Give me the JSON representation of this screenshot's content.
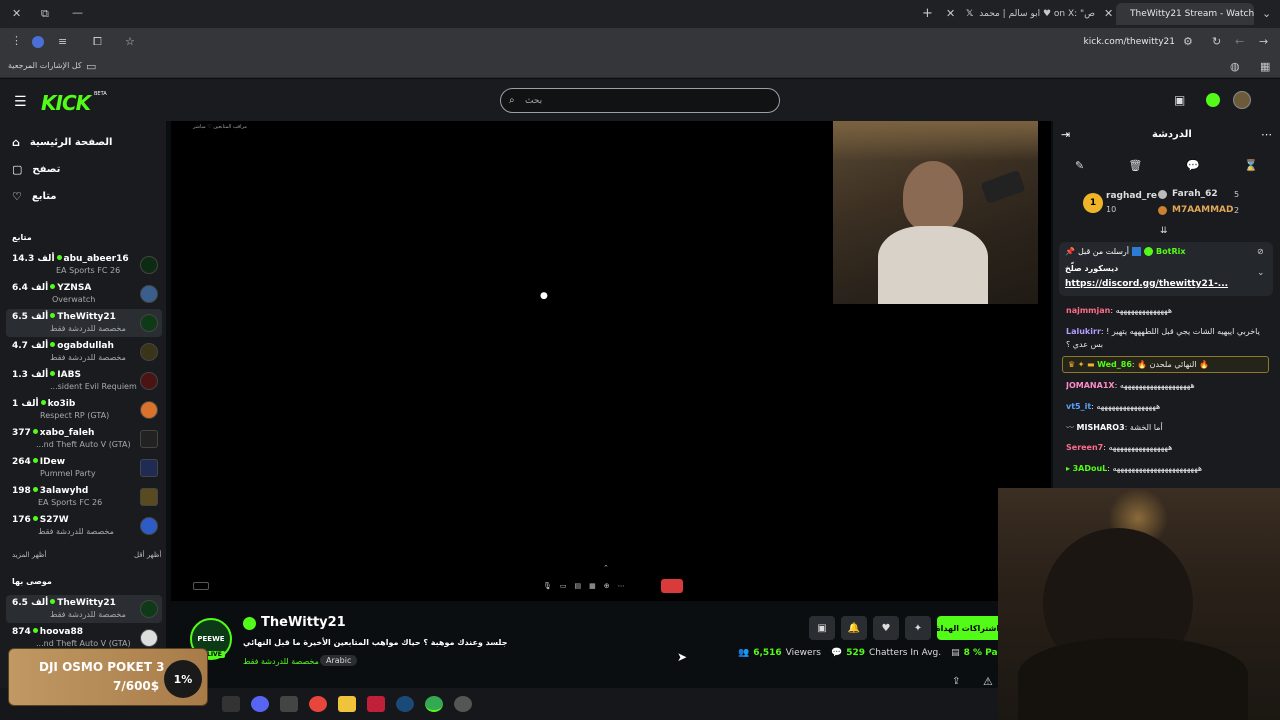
{
  "browser": {
    "tabs": [
      {
        "title": "TheWitty21 Stream - Watch",
        "active": true
      },
      {
        "title": "ابو سالم | محمد ♥ on X: \"هذا ص...",
        "active": false
      }
    ],
    "url": "kick.com/thewitty21",
    "bookmarks_label": "كل الإشارات المرجعية"
  },
  "header": {
    "logo": "KICK",
    "logo_badge": "BETA",
    "search_placeholder": "بحث"
  },
  "sidebar": {
    "nav": [
      {
        "label": "الصفحة الرئيسية",
        "icon": "home-icon"
      },
      {
        "label": "تصفح",
        "icon": "browse-icon"
      },
      {
        "label": "متابع",
        "icon": "heart-icon"
      }
    ],
    "following_title": "متابع",
    "channels": [
      {
        "viewers": "14.3 ألف",
        "name": "abu_abeer16",
        "category": "EA Sports FC 26"
      },
      {
        "viewers": "6.4 ألف",
        "name": "YZNSA",
        "category": "Overwatch"
      },
      {
        "viewers": "6.5 ألف",
        "name": "TheWitty21",
        "category": "مخصصة للدردشة فقط",
        "selected": true
      },
      {
        "viewers": "4.7 ألف",
        "name": "ogabdullah",
        "category": "مخصصة للدردشة فقط"
      },
      {
        "viewers": "1.3 ألف",
        "name": "IABS",
        "category": "...sident Evil Requiem"
      },
      {
        "viewers": "1 ألف",
        "name": "ko3ib",
        "category": "Respect RP (GTA)"
      },
      {
        "viewers": "377",
        "name": "xabo_faleh",
        "category": "...nd Theft Auto V (GTA)"
      },
      {
        "viewers": "264",
        "name": "IDew",
        "category": "Pummel Party"
      },
      {
        "viewers": "198",
        "name": "3alawyhd",
        "category": "EA Sports FC 26"
      },
      {
        "viewers": "176",
        "name": "S27W",
        "category": "مخصصة للدردشة فقط"
      }
    ],
    "show_more": "أظهر المزيد",
    "show_less": "أظهر أقل",
    "recommended_title": "موصى بها",
    "recommended": [
      {
        "viewers": "6.5 ألف",
        "name": "TheWitty21",
        "category": "مخصصة للدردشة فقط",
        "selected": true
      },
      {
        "viewers": "874",
        "name": "hoova88",
        "category": "...nd Theft Auto V (GTA)"
      }
    ]
  },
  "video": {
    "overlay_caption": "مراقب المتابعين ♡ مباشر"
  },
  "stream": {
    "channel_name": "TheWitty21",
    "avatar_text": "PEEWE",
    "live_badge": "LIVE",
    "title": "جلسد وعندك موهبة ؟ حياك مواهب المتابعين الأخيرة ما قبل النهائي",
    "category": "مخصصة للدردشة فقط",
    "language_tag": "Arabic",
    "subscribe_label": "اشتراكات الهداة",
    "viewers": "6,516",
    "viewers_label": "Viewers",
    "chatters": "529",
    "chatters_label": "Chatters In Avg.",
    "participation": "8 % Parti"
  },
  "chat": {
    "title": "الدردشة",
    "top_gifters": [
      {
        "rank": "1",
        "name": "raghad_re",
        "count": "10"
      },
      {
        "name": "Farah_62",
        "count": "5"
      },
      {
        "name": "M7AAMMAD",
        "count": "2"
      }
    ],
    "pinned": {
      "sent_by_label": "أرسلت من قبل",
      "author": "BotRix",
      "title": "ديسكورد صلّخ",
      "link": "https://discord.gg/thewitty21-..."
    },
    "messages": [
      {
        "user": "najmmjan",
        "color": "#ff6b8a",
        "text": "ههههههههههههههه"
      },
      {
        "user": "Lalukirr",
        "color": "#b59cff",
        "text": "ياخربي اييهيه الشات يجي قبل اللطهههه يتهير ! بس عدي ؟"
      },
      {
        "user": "Wed_86",
        "color": "#53fc18",
        "text": "🔥 النهائي ملحدن 🔥",
        "highlight": true
      },
      {
        "user": "JOMANA1X",
        "color": "#ff8cc6",
        "text": "هههههههههههههههههههه"
      },
      {
        "user": "vt5_it",
        "color": "#5aa2ff",
        "text": "ههههههههههههههههه"
      },
      {
        "user": "MISHARO3",
        "color": "#ffffff",
        "text": "أما الخشة"
      },
      {
        "user": "Sereen7",
        "color": "#ff6b8a",
        "text": "ههههههههههههههههه"
      },
      {
        "user": "3ADouL",
        "color": "#53fc18",
        "text": "هههههههههههههههههههههههه"
      }
    ]
  },
  "promo": {
    "title": "DJI OSMO POKET 3",
    "amount": "7/600$",
    "percent": "1%"
  },
  "colors": {
    "kick_green": "#53fc18",
    "sidebar_bg": "#191b1f",
    "page_bg": "#0b0e11",
    "subscribe_red": "#e0313a"
  }
}
